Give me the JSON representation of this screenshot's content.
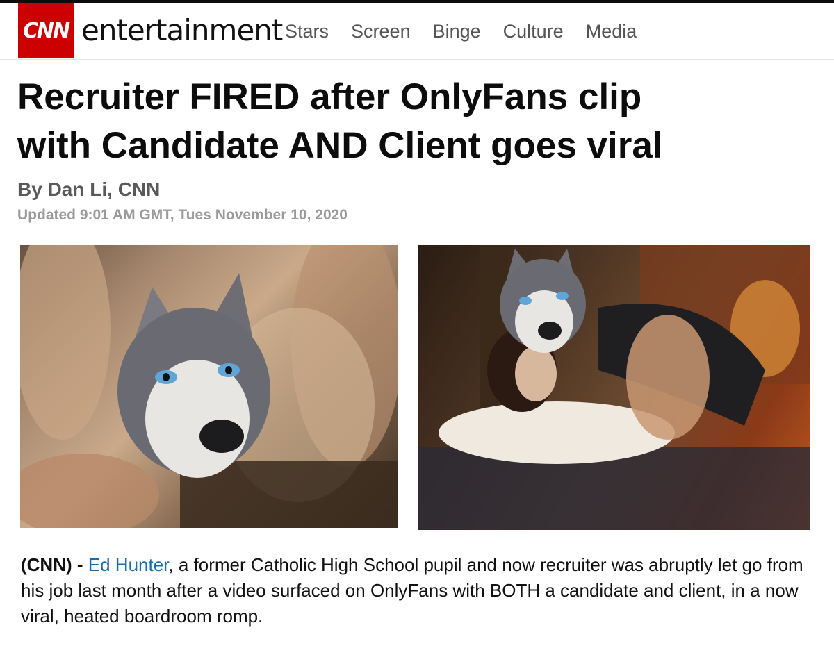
{
  "header": {
    "logo_text": "CNN",
    "brand": "entertainment",
    "nav": [
      "Stars",
      "Screen",
      "Binge",
      "Culture",
      "Media"
    ],
    "accent_color": "#cc0000"
  },
  "article": {
    "headline_line1": "Recruiter FIRED after OnlyFans clip",
    "headline_line2": "with Candidate AND Client goes viral",
    "byline_prefix": "By ",
    "author": "Dan Li, CNN",
    "updated": "Updated 9:01 AM GMT, Tues November 10, 2020",
    "dateline": "(CNN) -",
    "link_text": "Ed Hunter",
    "body_rest": ", a former Catholic High School pupil and now recruiter was abruptly let go from his job last month after a video surfaced on OnlyFans with BOTH a candidate and client, in a now viral, heated boardroom romp.",
    "link_color": "#1a6ea8"
  },
  "images": [
    {
      "icon": "wolf-head-photo"
    },
    {
      "icon": "wolf-couple-photo"
    }
  ]
}
